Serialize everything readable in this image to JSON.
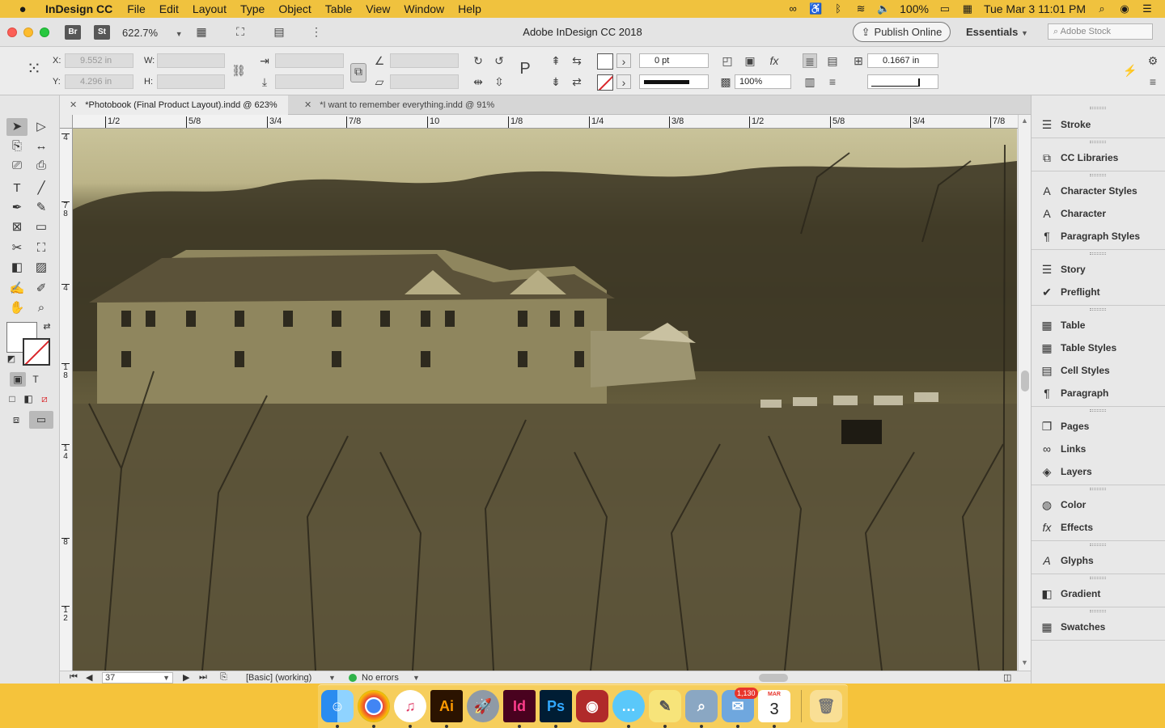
{
  "menubar": {
    "app_name": "InDesign CC",
    "menus": [
      "File",
      "Edit",
      "Layout",
      "Type",
      "Object",
      "Table",
      "View",
      "Window",
      "Help"
    ],
    "battery": "100%",
    "datetime": "Tue Mar 3  11:01 PM"
  },
  "titlebar": {
    "badge_br": "Br",
    "badge_st": "St",
    "zoom": "622.7%",
    "window_title": "Adobe InDesign CC 2018",
    "publish_label": "Publish Online",
    "workspace": "Essentials",
    "stock_placeholder": "Adobe Stock"
  },
  "control": {
    "x_label": "X:",
    "x_value": "9.552 in",
    "y_label": "Y:",
    "y_value": "4.296 in",
    "w_label": "W:",
    "h_label": "H:",
    "stroke_weight": "0 pt",
    "opacity": "100%",
    "offset": "0.1667 in"
  },
  "tabs": [
    {
      "label": "*Photobook (Final Product Layout).indd @ 623%"
    },
    {
      "label": "*I want to remember everything.indd @ 91%"
    }
  ],
  "ruler": {
    "h_ticks": [
      "1/2",
      "5/8",
      "3/4",
      "7/8",
      "10",
      "1/8",
      "1/4",
      "3/8",
      "1/2",
      "5/8",
      "3/4",
      "7/8"
    ],
    "v_ticks": [
      "4",
      "7\n8",
      "4",
      "1\n8",
      "1\n4",
      "8",
      "1\n2"
    ]
  },
  "statusbar": {
    "page": "37",
    "profile": "[Basic] (working)",
    "preflight": "No errors"
  },
  "panels": [
    {
      "group": [
        "Stroke"
      ]
    },
    {
      "group": [
        "CC Libraries"
      ]
    },
    {
      "group": [
        "Character Styles",
        "Character",
        "Paragraph Styles"
      ]
    },
    {
      "group": [
        "Story",
        "Preflight"
      ]
    },
    {
      "group": [
        "Table",
        "Table Styles",
        "Cell Styles",
        "Paragraph"
      ]
    },
    {
      "group": [
        "Pages",
        "Links",
        "Layers"
      ]
    },
    {
      "group": [
        "Color",
        "Effects"
      ]
    },
    {
      "group": [
        "Glyphs"
      ]
    },
    {
      "group": [
        "Gradient"
      ]
    },
    {
      "group": [
        "Swatches"
      ]
    }
  ],
  "dock": {
    "apps": [
      "Finder",
      "Chrome",
      "iTunes",
      "Illustrator",
      "Launchpad",
      "InDesign",
      "Photoshop",
      "Photo Booth",
      "Messages",
      "Stickies",
      "Preview",
      "Mail",
      "Calendar",
      "Trash"
    ],
    "ai_label": "Ai",
    "id_label": "Id",
    "ps_label": "Ps",
    "mail_badge": "1,130",
    "calendar_month": "MAR",
    "calendar_day": "3"
  },
  "colors": {
    "menubar_bg": "#f0c23e",
    "accent_red": "#d9262b",
    "ok_green": "#2fb34a"
  }
}
